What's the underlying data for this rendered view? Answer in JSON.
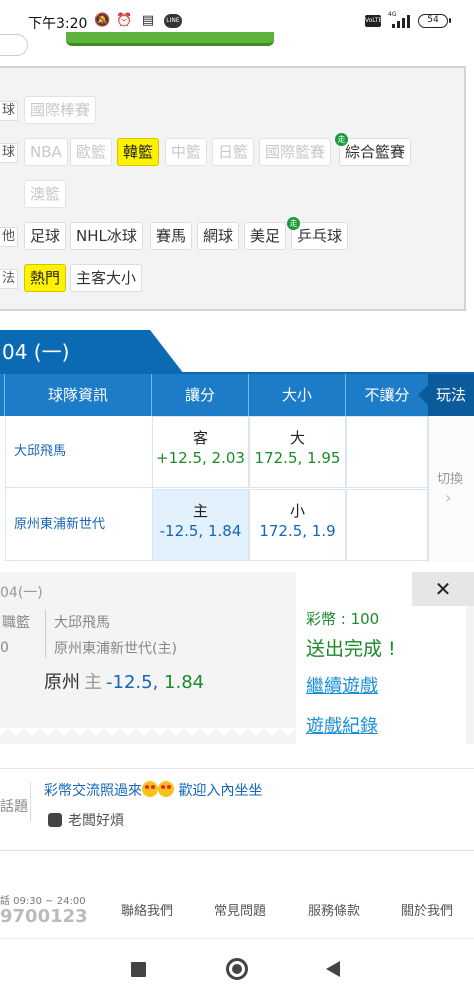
{
  "status": {
    "time": "下午3:20",
    "net": "4G",
    "battery": "54",
    "volte": "VoLTE",
    "line": "LINE"
  },
  "categories": {
    "rows": [
      {
        "label": "球",
        "items": [
          {
            "text": "國際棒賽",
            "state": "disabled"
          }
        ]
      },
      {
        "label": "球",
        "items": [
          {
            "text": "NBA",
            "state": "disabled"
          },
          {
            "text": "歐籃",
            "state": "disabled"
          },
          {
            "text": "韓籃",
            "state": "active"
          },
          {
            "text": "中籃",
            "state": "disabled"
          },
          {
            "text": "日籃",
            "state": "disabled"
          },
          {
            "text": "國際籃賽",
            "state": "disabled"
          },
          {
            "text": "綜合籃賽",
            "state": "normal",
            "badge": "走"
          }
        ]
      },
      {
        "label": "",
        "items": [
          {
            "text": "澳籃",
            "state": "disabled"
          }
        ]
      },
      {
        "label": "他",
        "items": [
          {
            "text": "足球",
            "state": "normal"
          },
          {
            "text": "NHL冰球",
            "state": "normal"
          },
          {
            "text": "賽馬",
            "state": "normal"
          },
          {
            "text": "網球",
            "state": "normal"
          },
          {
            "text": "美足",
            "state": "normal"
          },
          {
            "text": "乒乓球",
            "state": "normal",
            "badge": "走"
          }
        ]
      },
      {
        "label": "法",
        "items": [
          {
            "text": "熱門",
            "state": "active"
          },
          {
            "text": "主客大小",
            "state": "normal"
          }
        ]
      }
    ]
  },
  "date_tab": "04 (一)",
  "table": {
    "headers": [
      "球隊資訊",
      "讓分",
      "大小",
      "不讓分",
      "玩法"
    ],
    "rows": [
      {
        "team": "大邱飛馬",
        "handicap_side": "客",
        "handicap": "+12.5, 2.03",
        "ou_side": "大",
        "ou": "172.5, 1.95"
      },
      {
        "team": "原州東浦新世代",
        "handicap_side": "主",
        "handicap": "-12.5, 1.84",
        "ou_side": "小",
        "ou": "172.5, 1.9"
      }
    ],
    "switch_label": "切換",
    "switch_icon": "chevron-right-icon"
  },
  "receipt": {
    "date": "04(一)",
    "league": "職籃",
    "league_extra": "0",
    "away": "大邱飛馬",
    "home": "原州東浦新世代(主)",
    "pick_team": "原州",
    "pick_side": "主",
    "pick_line": "-12.5,",
    "pick_price": "1.84",
    "coins": "彩幣 : 100",
    "status": "送出完成 !",
    "continue": "繼續遊戲",
    "history": "遊戲紀錄",
    "close": "✕"
  },
  "topic": {
    "label": "話題",
    "title_a": "彩幣交流照過來",
    "title_b": " 歡迎入內坐坐",
    "author": "老闆好煩"
  },
  "footer": {
    "hours": "話 09:30 ~ 24:00",
    "phone": "9700123",
    "links": [
      "聯絡我們",
      "常見問題",
      "服務條款",
      "關於我們"
    ]
  },
  "colors": {
    "primary": "#0a6ab4",
    "header": "#1c7cc8",
    "green": "#1a8a2a",
    "blue": "#1565b8",
    "highlight": "#fff200"
  }
}
